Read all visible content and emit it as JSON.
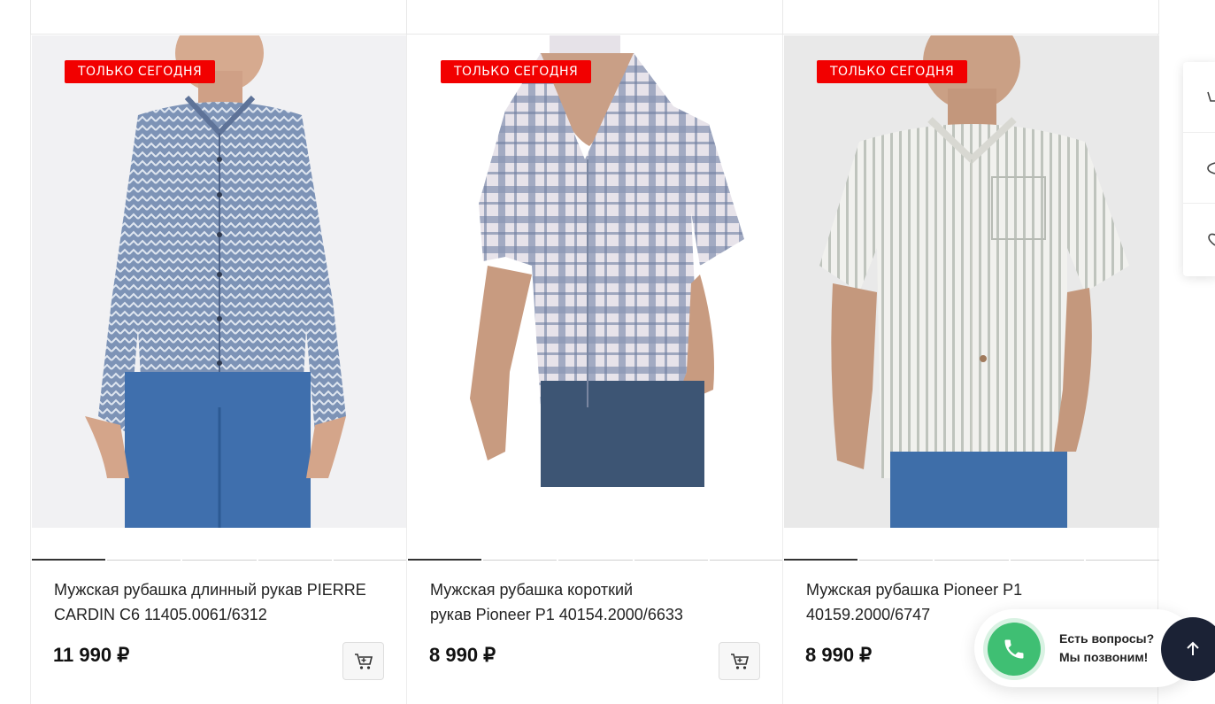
{
  "products": [
    {
      "badge": "ТОЛЬКО СЕГОДНЯ",
      "title_line1": "Мужская рубашка длинный рукав  PIERRE",
      "title_line2": "CARDIN C6 11405.0061/6312",
      "price": "11 990 ₽",
      "image_icon": "shirt-photo-blue-long-sleeve"
    },
    {
      "badge": "ТОЛЬКО СЕГОДНЯ",
      "title_line1": "Мужская рубашка короткий",
      "title_line2": "рукав Pioneer P1 40154.2000/6633",
      "price": "8 990 ₽",
      "image_icon": "shirt-photo-plaid-short-sleeve"
    },
    {
      "badge": "ТОЛЬКО СЕГОДНЯ",
      "title_line1": "Мужская рубашка Pioneer P1",
      "title_line2": "40159.2000/6747",
      "price": "8 990 ₽",
      "image_icon": "shirt-photo-striped-short-sleeve"
    }
  ],
  "callback": {
    "line1": "Есть вопросы?",
    "line2": "Мы позвоним!"
  },
  "colors": {
    "badge": "#f20000",
    "call_green": "#3fbf73",
    "scroll_top_bg": "#1b2235"
  }
}
